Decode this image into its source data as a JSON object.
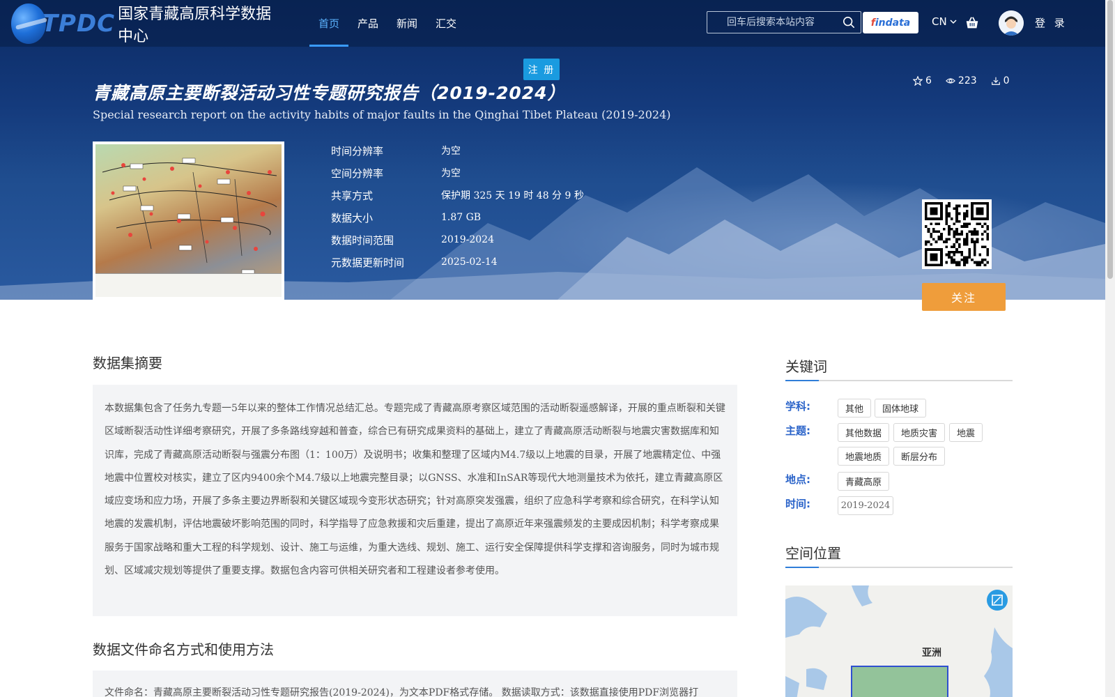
{
  "header": {
    "logo_tpdc": "TPDC",
    "logo_cn": "国家青藏高原科学数据中心",
    "nav": [
      "首页",
      "产品",
      "新闻",
      "汇交"
    ],
    "search_placeholder": "回车后搜索本站内容",
    "findata_a": "f",
    "findata_b": "indata",
    "lang": "CN",
    "login": "登 录",
    "register": "注 册"
  },
  "dataset": {
    "title_cn": "青藏高原主要断裂活动习性专题研究报告（2019-2024）",
    "title_en": "Special research report on the activity habits of major faults in the Qinghai Tibet Plateau (2019-2024)",
    "stars": "6",
    "views": "223",
    "downloads": "0",
    "meta": [
      {
        "label": "时间分辨率",
        "value": "为空"
      },
      {
        "label": "空间分辨率",
        "value": "为空"
      },
      {
        "label": "共享方式",
        "value": "保护期 325 天 19 时 48 分 9 秒"
      },
      {
        "label": "数据大小",
        "value": "1.87 GB"
      },
      {
        "label": "数据时间范围",
        "value": "2019-2024"
      },
      {
        "label": "元数据更新时间",
        "value": "2025-02-14"
      }
    ],
    "follow": "关注"
  },
  "main": {
    "abstract_title": "数据集摘要",
    "abstract": "本数据集包含了任务九专题一5年以来的整体工作情况总结汇总。专题完成了青藏高原考察区域范围的活动断裂遥感解译，开展的重点断裂和关键区域断裂活动性详细考察研究，开展了多条路线穿越和普查，综合已有研究成果资料的基础上，建立了青藏高原活动断裂与地震灾害数据库和知识库，完成了青藏高原活动断裂与强震分布图（1：100万）及说明书；收集和整理了区域内M4.7级以上地震的目录，开展了地震精定位、中强地震中位置校对核实，建立了区内9400余个M4.7级以上地震完整目录；以GNSS、水准和InSAR等现代大地测量技术为依托，建立青藏高原区域应变场和应力场，开展了多条主要边界断裂和关键区域现今变形状态研究；针对高原突发强震，组织了应急科学考察和综合研究，在科学认知地震的发震机制，评估地震破坏影响范围的同时，科学指导了应急救援和灾后重建，提出了高原近年来强震频发的主要成因机制；科学考察成果服务于国家战略和重大工程的科学规划、设计、施工与运维，为重大选线、规划、施工、运行安全保障提供科学支撑和咨询服务，同时为城市规划、区域减灾规划等提供了重要支撑。数据包含内容可供相关研究者和工程建设者参考使用。",
    "file_title": "数据文件命名方式和使用方法",
    "file_text": "文件命名：青藏高原主要断裂活动习性专题研究报告(2019-2024)，为文本PDF格式存储。 数据读取方式：该数据直接使用PDF浏览器打"
  },
  "sidebar": {
    "keywords_title": "关键词",
    "subject_label": "学科:",
    "subject_tags": [
      "其他",
      "固体地球"
    ],
    "theme_label": "主题:",
    "theme_tags": [
      "其他数据",
      "地质灾害",
      "地震",
      "地震地质",
      "断层分布"
    ],
    "place_label": "地点:",
    "place_tags": [
      "青藏高原"
    ],
    "time_label": "时间:",
    "time_tags": [
      "2019-2024"
    ],
    "spatial_title": "空间位置",
    "map_label": "亚洲"
  },
  "colors": {
    "accent": "#3a9bff",
    "follow": "#ef9d3b",
    "register": "#1a9be0",
    "keyword_label": "#2a63c9"
  }
}
